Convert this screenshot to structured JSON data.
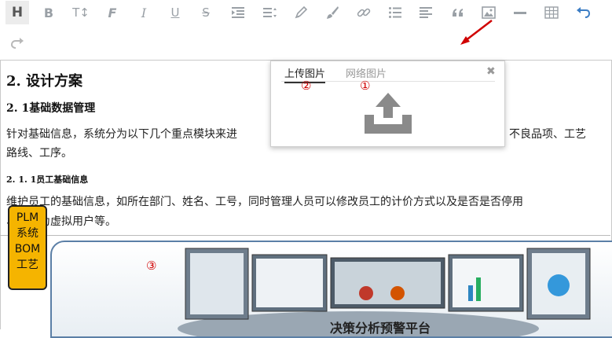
{
  "toolbar": {
    "buttons": [
      {
        "name": "heading",
        "glyph": "H"
      },
      {
        "name": "bold",
        "glyph": "B"
      },
      {
        "name": "font-size",
        "glyph": "T↕"
      },
      {
        "name": "font-family",
        "glyph": "F"
      },
      {
        "name": "italic",
        "glyph": "I"
      },
      {
        "name": "underline",
        "glyph": "U"
      },
      {
        "name": "strikethrough",
        "glyph": "S"
      }
    ]
  },
  "document": {
    "h2": "2. 设计方案",
    "h3": "2. 1基础数据管理",
    "p1_line1_left": "针对基础信息，系统分为以下几个重点模块来进",
    "p1_line1_right": "不良品项、工艺",
    "p1_line2": "路线、工序。",
    "h4": "2. 1. 1员工基础信息",
    "p2_line1": "维护员工的基础信息，如所在部门、姓名、工号，同时管理人员可以修改员工的计价方式以及是否是否停用",
    "p2_line2": "、是否为虚拟用户等。",
    "plm_box": [
      "PLM",
      "系统",
      "BOM",
      "工艺"
    ],
    "caption": "决策分析预警平台"
  },
  "popup": {
    "tab_upload": "上传图片",
    "tab_web": "网络图片",
    "close_glyph": "✖"
  },
  "annotations": {
    "one": "①",
    "two": "②",
    "three": "③"
  },
  "colors": {
    "accent_blue": "#3c7dc4",
    "annotation_red": "#d00000",
    "plm_yellow": "#f5b400"
  }
}
